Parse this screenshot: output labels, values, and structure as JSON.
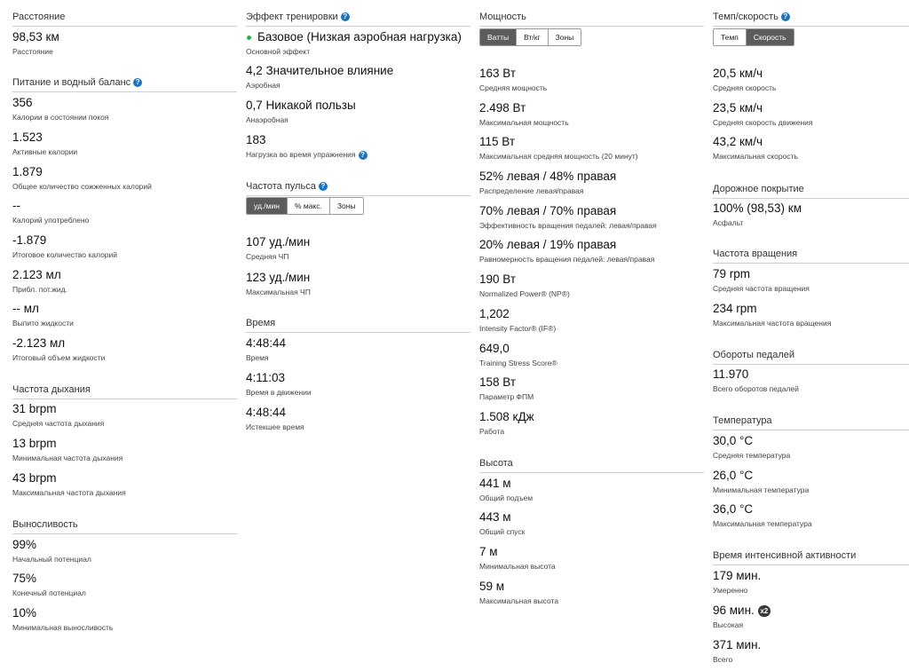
{
  "col1": {
    "distance": {
      "title": "Расстояние",
      "stats": [
        {
          "value": "98,53 км",
          "label": "Расстояние"
        }
      ]
    },
    "nutrition": {
      "title": "Питание и водный баланс",
      "stats": [
        {
          "value": "356",
          "label": "Калории в состоянии покоя"
        },
        {
          "value": "1.523",
          "label": "Активные калории"
        },
        {
          "value": "1.879",
          "label": "Общее количество сожженных калорий"
        },
        {
          "value": "--",
          "label": "Калорий употреблено"
        },
        {
          "value": "-1.879",
          "label": "Итоговое количество калорий"
        },
        {
          "value": "2.123 мл",
          "label": "Прибл. пот.жид."
        },
        {
          "value": "-- мл",
          "label": "Выпито жидкости"
        },
        {
          "value": "-2.123 мл",
          "label": "Итоговый объем жидкости"
        }
      ]
    },
    "respiration": {
      "title": "Частота дыхания",
      "stats": [
        {
          "value": "31 brpm",
          "label": "Средняя частота дыхания"
        },
        {
          "value": "13 brpm",
          "label": "Минимальная частота дыхания"
        },
        {
          "value": "43 brpm",
          "label": "Максимальная частота дыхания"
        }
      ]
    },
    "stamina": {
      "title": "Выносливость",
      "stats": [
        {
          "value": "99%",
          "label": "Начальный потенциал"
        },
        {
          "value": "75%",
          "label": "Конечный потенциал"
        },
        {
          "value": "10%",
          "label": "Минимальная выносливость"
        }
      ]
    }
  },
  "col2": {
    "training_effect": {
      "title": "Эффект тренировки",
      "stats": [
        {
          "value": "Базовое (Низкая аэробная нагрузка)",
          "label": "Основной эффект"
        },
        {
          "value": "4,2 Значительное влияние",
          "label": "Аэробная"
        },
        {
          "value": "0,7 Никакой пользы",
          "label": "Анаэробная"
        },
        {
          "value": "183",
          "label": "Нагрузка во время упражнения"
        }
      ]
    },
    "heart_rate": {
      "title": "Частота пульса",
      "tabs": [
        "уд./мин",
        "% макс.",
        "Зоны"
      ],
      "stats": [
        {
          "value": "107 уд./мин",
          "label": "Средняя ЧП"
        },
        {
          "value": "123 уд./мин",
          "label": "Максимальная ЧП"
        }
      ]
    },
    "time": {
      "title": "Время",
      "stats": [
        {
          "value": "4:48:44",
          "label": "Время"
        },
        {
          "value": "4:11:03",
          "label": "Время в движении"
        },
        {
          "value": "4:48:44",
          "label": "Истекшее время"
        }
      ]
    }
  },
  "col3": {
    "power": {
      "title": "Мощность",
      "tabs": [
        "Ватты",
        "Вт/кг",
        "Зоны"
      ],
      "stats": [
        {
          "value": "163 Вт",
          "label": "Средняя мощность"
        },
        {
          "value": "2.498 Вт",
          "label": "Максимальная мощность"
        },
        {
          "value": "115 Вт",
          "label": "Максимальная средняя мощность (20 минут)"
        },
        {
          "value": "52% левая / 48% правая",
          "label": "Распределение левая/правая"
        },
        {
          "value": "70% левая / 70% правая",
          "label": "Эффективность вращения педалей: левая/правая"
        },
        {
          "value": "20% левая / 19% правая",
          "label": "Равномерность вращения педалей: левая/правая"
        },
        {
          "value": "190 Вт",
          "label": "Normalized Power® (NP®)"
        },
        {
          "value": "1,202",
          "label": "Intensity Factor® (IF®)"
        },
        {
          "value": "649,0",
          "label": "Training Stress Score®"
        },
        {
          "value": "158 Вт",
          "label": "Параметр ФПМ"
        },
        {
          "value": "1.508 кДж",
          "label": "Работа"
        }
      ]
    },
    "elevation": {
      "title": "Высота",
      "stats": [
        {
          "value": "441 м",
          "label": "Общий подъем"
        },
        {
          "value": "443 м",
          "label": "Общий спуск"
        },
        {
          "value": "7 м",
          "label": "Минимальная высота"
        },
        {
          "value": "59 м",
          "label": "Максимальная высота"
        }
      ]
    }
  },
  "col4": {
    "pace": {
      "title": "Темп/скорость",
      "tabs": [
        "Темп",
        "Скорость"
      ],
      "stats": [
        {
          "value": "20,5 км/ч",
          "label": "Средняя скорость"
        },
        {
          "value": "23,5 км/ч",
          "label": "Средняя скорость движения"
        },
        {
          "value": "43,2 км/ч",
          "label": "Максимальная скорость"
        }
      ]
    },
    "surface": {
      "title": "Дорожное покрытие",
      "stats": [
        {
          "value": "100% (98,53) км",
          "label": "Асфальт"
        }
      ]
    },
    "cadence": {
      "title": "Частота вращения",
      "stats": [
        {
          "value": "79 rpm",
          "label": "Средняя частота вращения"
        },
        {
          "value": "234 rpm",
          "label": "Максимальная частота вращения"
        }
      ]
    },
    "strokes": {
      "title": "Обороты педалей",
      "stats": [
        {
          "value": "11.970",
          "label": "Всего оборотов педалей"
        }
      ]
    },
    "temperature": {
      "title": "Температура",
      "stats": [
        {
          "value": "30,0 °C",
          "label": "Средняя температура"
        },
        {
          "value": "26,0 °C",
          "label": "Минимальная температура"
        },
        {
          "value": "36,0 °C",
          "label": "Максимальная температура"
        }
      ]
    },
    "intensity": {
      "title": "Время интенсивной активности",
      "vigorous_badge": "x2",
      "stats": [
        {
          "value": "179 мин.",
          "label": "Умеренно"
        },
        {
          "value": "96 мин.",
          "label": "Высокая"
        },
        {
          "value": "371 мин.",
          "label": "Всего"
        }
      ]
    }
  },
  "help_icon_glyph": "?",
  "colors": {
    "help_icon": "#1a74c2",
    "primary_effect_dot": "#2bb24c",
    "tab_active": "#5c5c5c"
  }
}
